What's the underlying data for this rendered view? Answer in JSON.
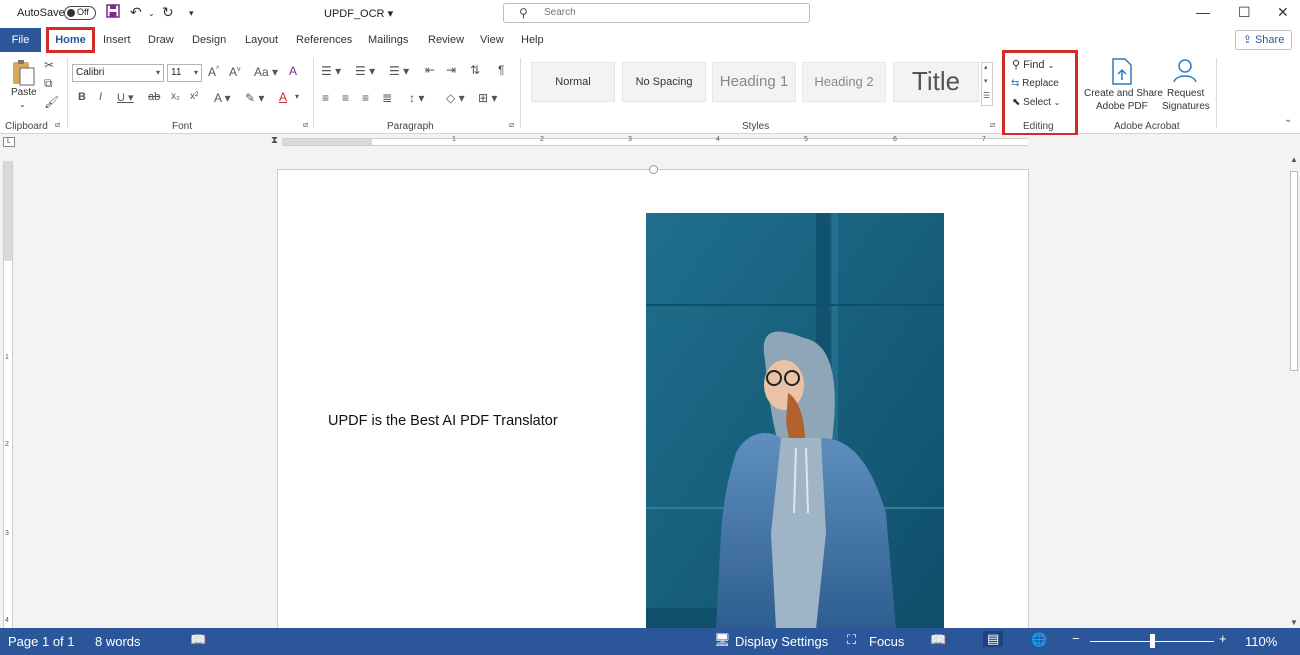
{
  "titlebar": {
    "autosave_label": "AutoSave",
    "autosave_state": "Off",
    "document_title": "UPDF_OCR",
    "search_placeholder": "Search"
  },
  "tabs": {
    "file": "File",
    "home": "Home",
    "items": [
      "Insert",
      "Draw",
      "Design",
      "Layout",
      "References",
      "Mailings",
      "Review",
      "View",
      "Help"
    ],
    "share": "Share"
  },
  "ribbon": {
    "clipboard": {
      "label": "Clipboard",
      "paste": "Paste"
    },
    "font": {
      "label": "Font",
      "family": "Calibri",
      "size": "11"
    },
    "paragraph": {
      "label": "Paragraph"
    },
    "styles": {
      "label": "Styles",
      "items": [
        "Normal",
        "No Spacing",
        "Heading 1",
        "Heading 2",
        "Title"
      ]
    },
    "editing": {
      "label": "Editing",
      "find": "Find",
      "replace": "Replace",
      "select": "Select"
    },
    "adobe": {
      "label": "Adobe Acrobat",
      "create_share_line1": "Create and Share",
      "create_share_line2": "Adobe PDF",
      "request_line1": "Request",
      "request_line2": "Signatures"
    }
  },
  "ruler": {
    "numbers": [
      "1",
      "2",
      "3",
      "4",
      "5",
      "6",
      "7"
    ]
  },
  "vruler": {
    "numbers": [
      "1",
      "2",
      "3",
      "4"
    ]
  },
  "document": {
    "body_text": "UPDF is the Best AI PDF Translator"
  },
  "status": {
    "page": "Page 1 of 1",
    "words": "8 words",
    "display_settings": "Display Settings",
    "focus": "Focus",
    "zoom": "110%",
    "zoom_level": 0.5
  },
  "colors": {
    "accent": "#2b579a",
    "highlight_box": "#d32a2a"
  }
}
